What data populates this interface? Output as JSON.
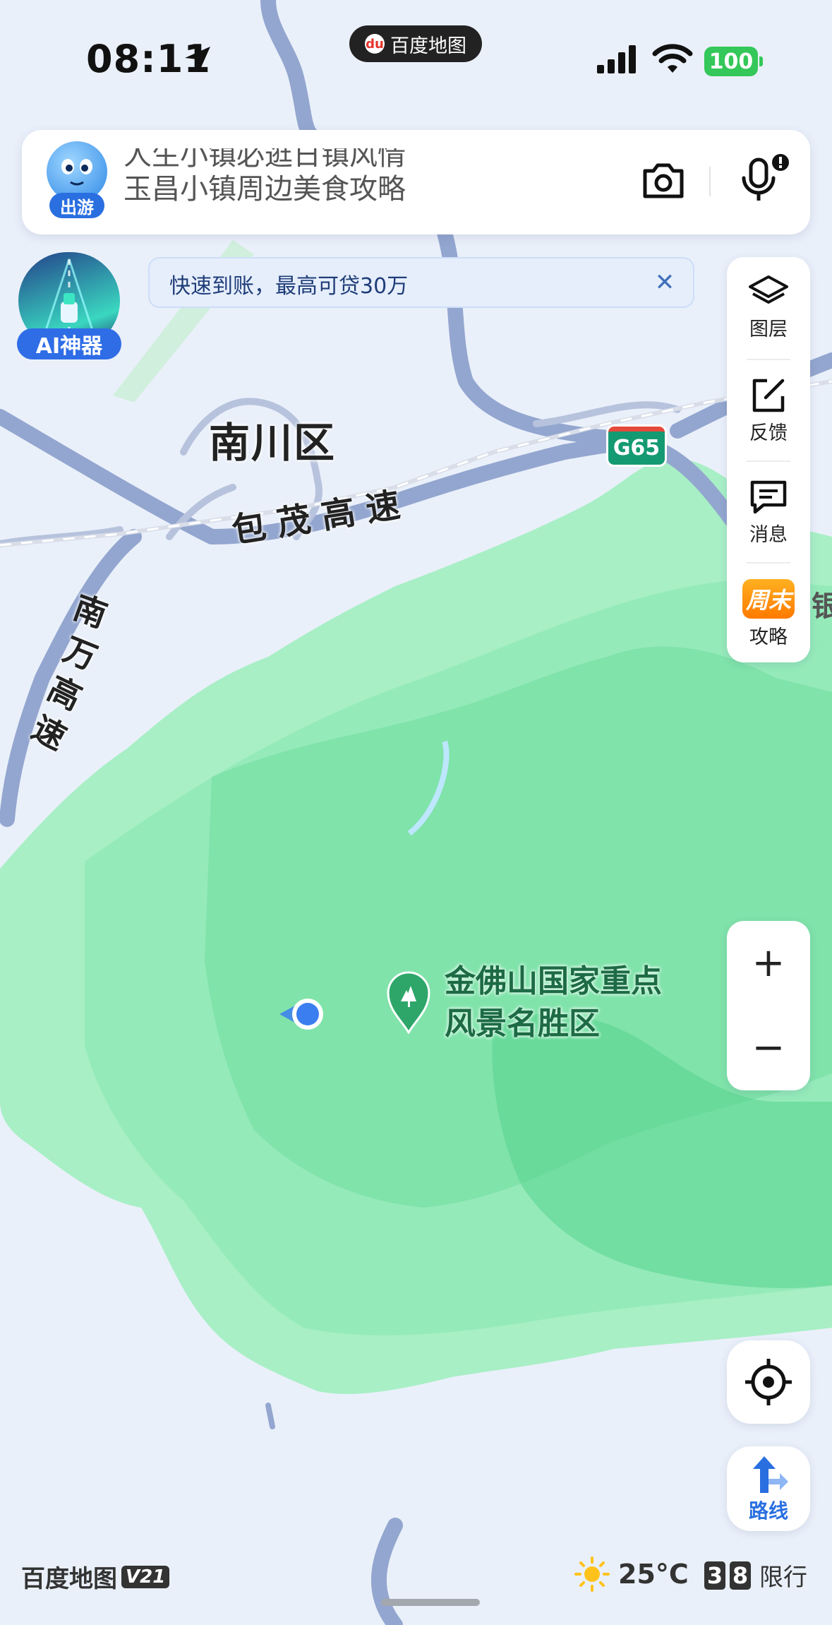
{
  "status_bar": {
    "time": "08:11",
    "app_name": "百度地图",
    "app_badge": "du",
    "battery": "100"
  },
  "search": {
    "ticker_lines": [
      "人生小镇必逛日镇风情",
      "玉昌小镇周边美食攻略"
    ],
    "avatar_badge": "出游"
  },
  "ai_button": {
    "label": "AI神器"
  },
  "ad_banner": {
    "text": "快速到账，最高可贷30万",
    "close": "✕"
  },
  "right_panel": {
    "items": [
      {
        "label": "图层",
        "icon": "layers-icon"
      },
      {
        "label": "反馈",
        "icon": "edit-icon"
      },
      {
        "label": "消息",
        "icon": "message-icon"
      },
      {
        "label": "攻略",
        "icon": "weekend-icon",
        "badge": "周末"
      }
    ]
  },
  "map": {
    "district": "南川区",
    "road_baomao": [
      "包",
      "茂",
      "高",
      "速"
    ],
    "road_nanwan": [
      "南",
      "万",
      "高",
      "速"
    ],
    "highway_shield": "G65",
    "poi": {
      "line1": "金佛山国家重点",
      "line2": "风景名胜区"
    },
    "edge_label": "银"
  },
  "zoom": {
    "in": "+",
    "out": "−"
  },
  "route_button": {
    "label": "路线"
  },
  "bottom_bar": {
    "brand": "百度地图",
    "version": "V21",
    "temperature": "25°C",
    "plates": [
      "3",
      "8"
    ],
    "restriction_label": "限行"
  },
  "colors": {
    "accent": "#2a6fe0",
    "forest": "#8ee8b4",
    "battery": "#34c759",
    "highway_shield": "#149a72"
  }
}
